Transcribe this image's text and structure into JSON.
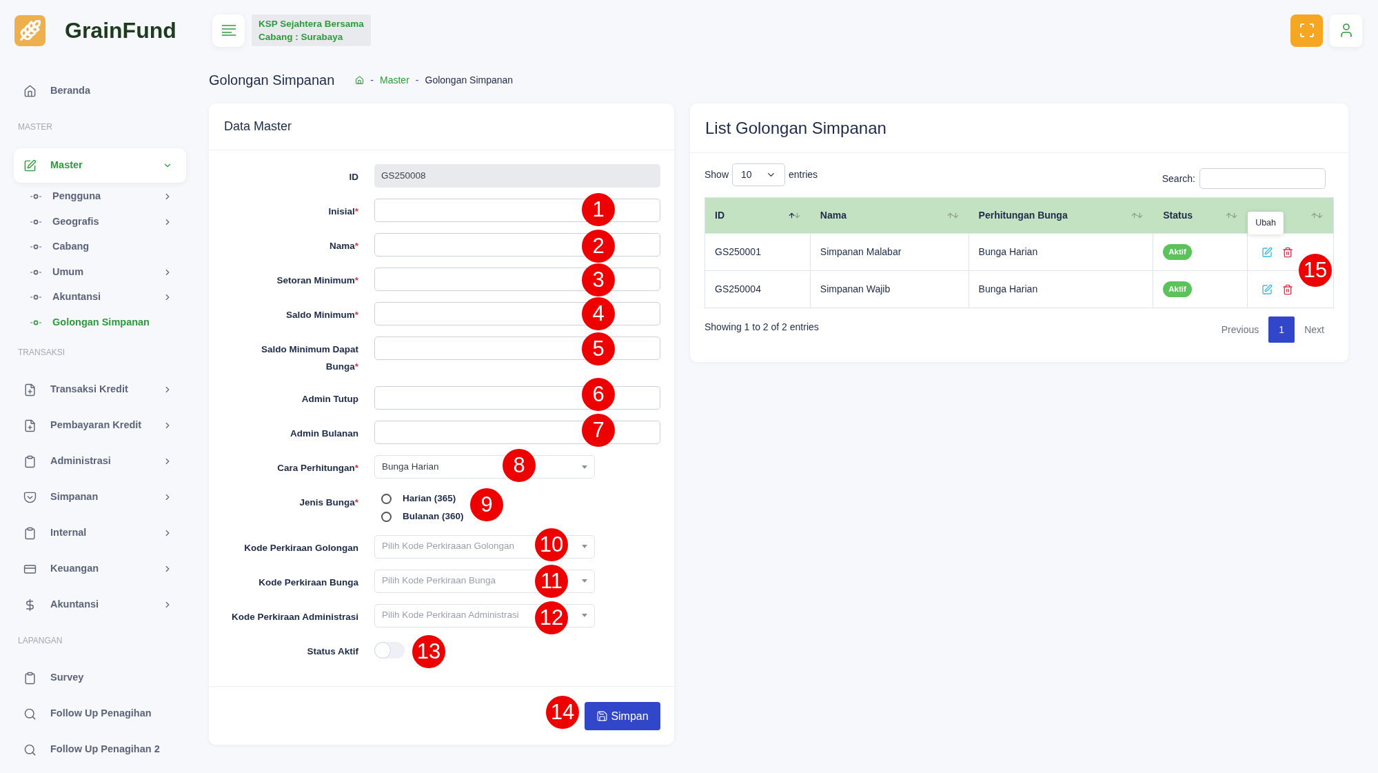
{
  "brand": {
    "name": "GrainFund"
  },
  "org": {
    "name": "KSP Sejahtera Bersama",
    "branch": "Cabang : Surabaya"
  },
  "sidebar": {
    "sections": [
      {
        "items": [
          {
            "label": "Beranda",
            "selected": false,
            "expandable": false
          }
        ]
      },
      {
        "heading": "MASTER",
        "items": [
          {
            "label": "Master",
            "selected": true,
            "expandable": true,
            "expanded": true,
            "children": [
              {
                "label": "Pengguna",
                "selected": false,
                "expandable": true
              },
              {
                "label": "Geografis",
                "selected": false,
                "expandable": true
              },
              {
                "label": "Cabang",
                "selected": false,
                "expandable": false
              },
              {
                "label": "Umum",
                "selected": false,
                "expandable": true
              },
              {
                "label": "Akuntansi",
                "selected": false,
                "expandable": true
              },
              {
                "label": "Golongan Simpanan",
                "selected": true,
                "expandable": false
              }
            ]
          }
        ]
      },
      {
        "heading": "TRANSAKSI",
        "items": [
          {
            "label": "Transaksi Kredit",
            "selected": false,
            "expandable": true
          },
          {
            "label": "Pembayaran Kredit",
            "selected": false,
            "expandable": true
          },
          {
            "label": "Administrasi",
            "selected": false,
            "expandable": true
          },
          {
            "label": "Simpanan",
            "selected": false,
            "expandable": true
          },
          {
            "label": "Internal",
            "selected": false,
            "expandable": true
          },
          {
            "label": "Keuangan",
            "selected": false,
            "expandable": true
          },
          {
            "label": "Akuntansi",
            "selected": false,
            "expandable": true
          }
        ]
      },
      {
        "heading": "LAPANGAN",
        "items": [
          {
            "label": "Survey",
            "selected": false,
            "expandable": false
          },
          {
            "label": "Follow Up Penagihan",
            "selected": false,
            "expandable": false
          },
          {
            "label": "Follow Up Penagihan 2",
            "selected": false,
            "expandable": false
          }
        ]
      }
    ]
  },
  "page": {
    "title": "Golongan Simpanan",
    "breadcrumb": [
      {
        "label": "Master",
        "link": true
      },
      {
        "label": "Golongan Simpanan",
        "link": false
      }
    ],
    "separator": "-"
  },
  "form": {
    "title": "Data Master",
    "fields": [
      {
        "kind": "readonly",
        "label": "ID",
        "value": "GS250008"
      },
      {
        "kind": "text",
        "label": "Inisial",
        "required_mark": "*"
      },
      {
        "kind": "text",
        "label": "Nama",
        "required_mark": "*"
      },
      {
        "kind": "text",
        "label": "Setoran Minimum",
        "required_mark": "*"
      },
      {
        "kind": "text",
        "label": "Saldo Minimum",
        "required_mark": "*"
      },
      {
        "kind": "text",
        "label": "Saldo Minimum Dapat Bunga",
        "required_mark": "*"
      },
      {
        "kind": "text",
        "label": "Admin Tutup"
      },
      {
        "kind": "text",
        "label": "Admin Bulanan"
      },
      {
        "kind": "select",
        "label": "Cara Perhitungan",
        "required_mark": "*",
        "value": "Bunga Harian"
      },
      {
        "kind": "radio",
        "label": "Jenis Bunga",
        "required_mark": "*",
        "options": [
          {
            "label": "Harian (365)",
            "selected": false
          },
          {
            "label": "Bulanan (360)",
            "selected": false
          }
        ]
      },
      {
        "kind": "select",
        "label": "Kode Perkiraan Golongan",
        "placeholder": "Pilih Kode Perkiraaan Golongan"
      },
      {
        "kind": "select",
        "label": "Kode Perkiraan Bunga",
        "placeholder": "Pilih Kode Perkiraan Bunga"
      },
      {
        "kind": "select",
        "label": "Kode Perkiraan Administrasi",
        "placeholder": "Pilih Kode Perkiraan Administrasi"
      },
      {
        "kind": "switch",
        "label": "Status Aktif",
        "on": false
      }
    ],
    "submit": "Simpan"
  },
  "list": {
    "title": "List Golongan Simpanan",
    "show_label": "Show",
    "page_size": "10",
    "entries_label": "entries",
    "search_label": "Search:",
    "columns": [
      {
        "label": "ID",
        "sorted": true
      },
      {
        "label": "Nama",
        "sorted": false
      },
      {
        "label": "Perhitungan Bunga",
        "sorted": false
      },
      {
        "label": "Status",
        "sorted": false
      },
      {
        "sorted": false
      }
    ],
    "rows": [
      {
        "cells": [
          "GS250001",
          "Simpanan Malabar",
          "Bunga Harian"
        ],
        "status": "Aktif"
      },
      {
        "cells": [
          "GS250004",
          "Simpanan Wajib",
          "Bunga Harian"
        ],
        "status": "Aktif"
      }
    ],
    "tooltip": "Ubah",
    "info": "Showing 1 to 2 of 2 entries",
    "previous": "Previous",
    "pages": [
      {
        "label": "1",
        "selected": true
      }
    ],
    "next": "Next"
  },
  "annotations": [
    {
      "label": "1"
    },
    {
      "label": "2"
    },
    {
      "label": "3"
    },
    {
      "label": "4"
    },
    {
      "label": "5"
    },
    {
      "label": "6"
    },
    {
      "label": "7"
    },
    {
      "label": "8"
    },
    {
      "label": "9"
    },
    {
      "label": "10"
    },
    {
      "label": "11"
    },
    {
      "label": "12"
    },
    {
      "label": "13"
    },
    {
      "label": "14"
    },
    {
      "label": "15"
    }
  ]
}
